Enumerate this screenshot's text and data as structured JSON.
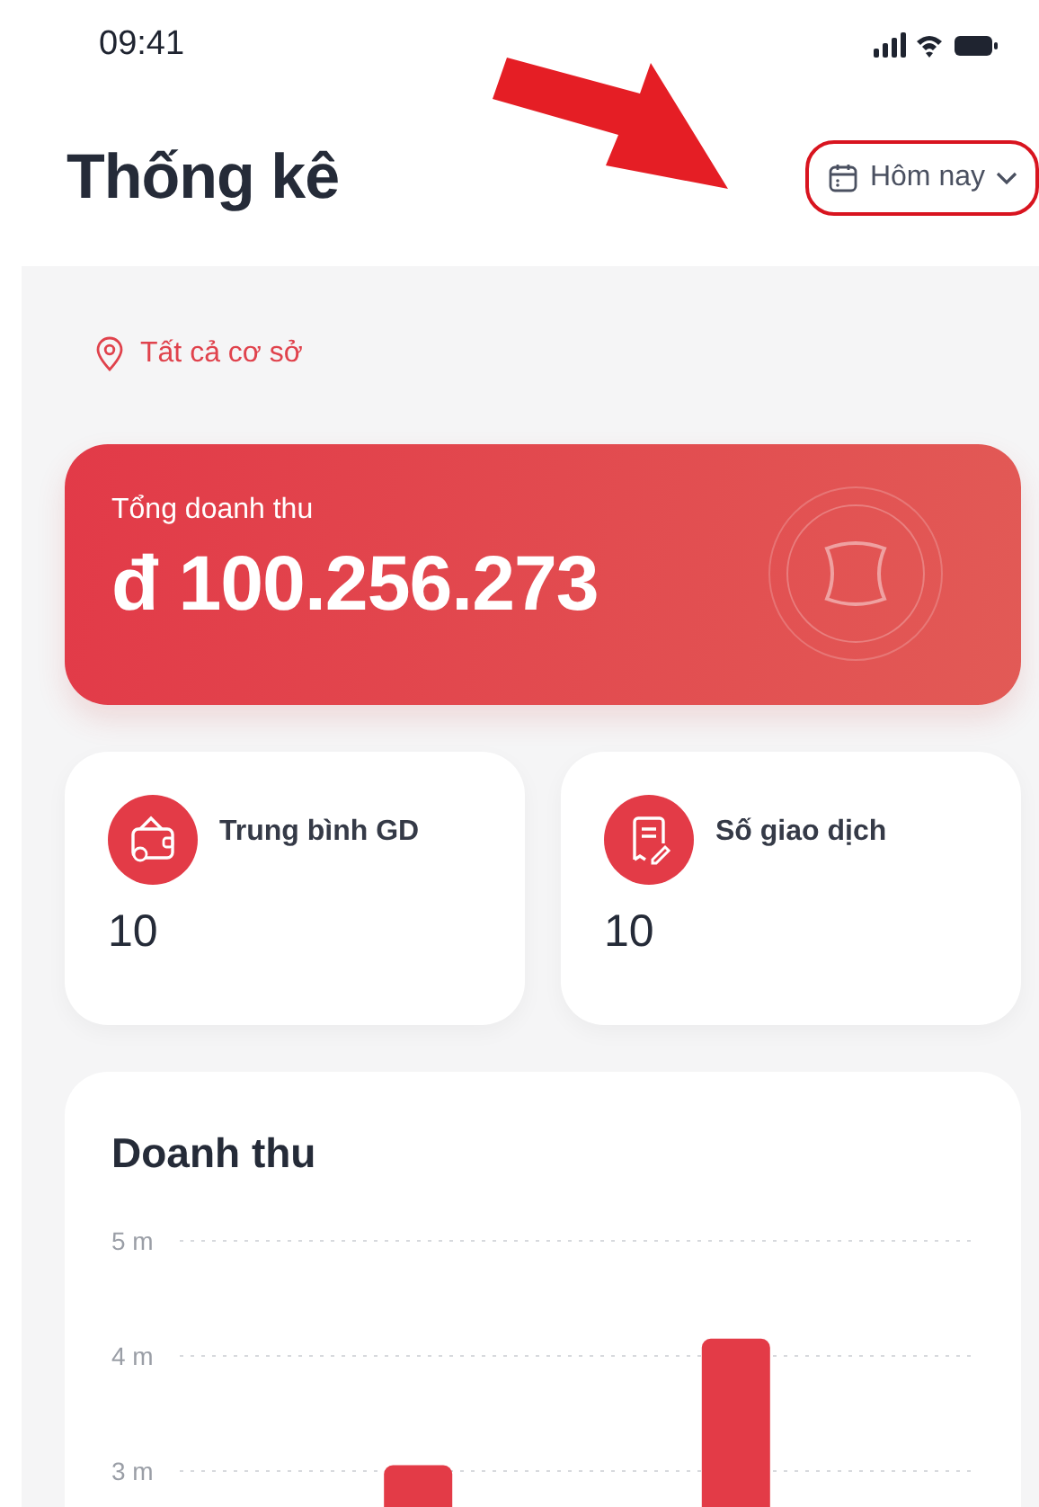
{
  "status_bar": {
    "time": "09:41"
  },
  "header": {
    "title": "Thống kê",
    "date_filter": {
      "label": "Hôm nay",
      "highlighted": true
    }
  },
  "location_filter": {
    "label": "Tất cả cơ sở"
  },
  "total_revenue": {
    "label": "Tổng doanh thu",
    "value": "đ 100.256.273"
  },
  "stats": [
    {
      "kind": "wallet",
      "label": "Trung bình GD",
      "value": "10"
    },
    {
      "kind": "receipt",
      "label": "Số giao dịch",
      "value": "10"
    }
  ],
  "revenue_chart": {
    "title": "Doanh thu",
    "chart_data": {
      "type": "bar",
      "values": [
        null,
        3.05,
        null,
        4.15,
        null
      ],
      "grid": true,
      "ylim": [
        0,
        5
      ],
      "yticks": [
        {
          "value": 3,
          "label": "3 m"
        },
        {
          "value": 4,
          "label": "4 m"
        },
        {
          "value": 5,
          "label": "5 m"
        }
      ]
    }
  }
}
